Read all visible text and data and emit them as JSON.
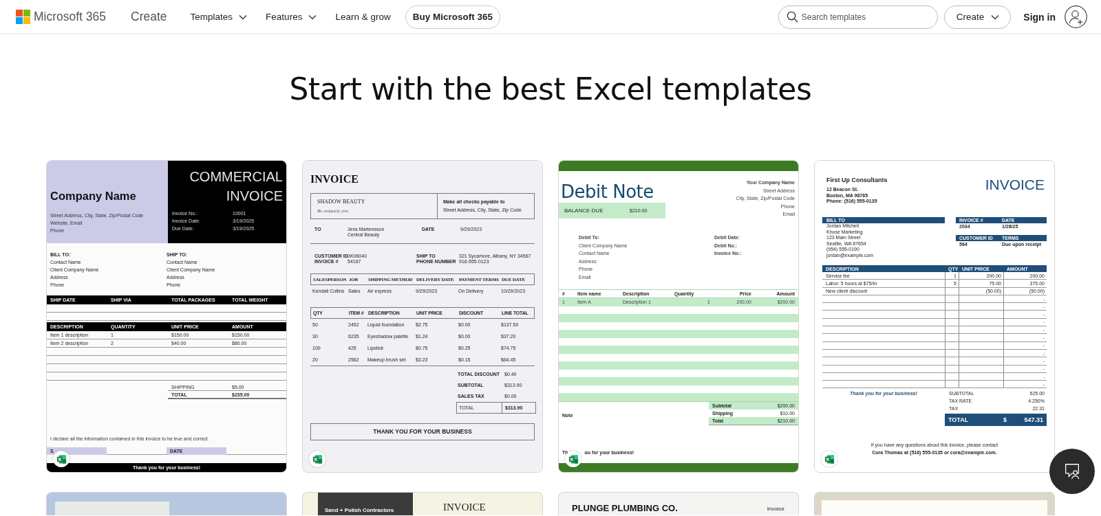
{
  "header": {
    "brand": "Microsoft 365",
    "section": "Create",
    "nav": [
      {
        "label": "Templates",
        "dropdown": true
      },
      {
        "label": "Features",
        "dropdown": true
      },
      {
        "label": "Learn & grow",
        "dropdown": false
      }
    ],
    "buy_button": "Buy Microsoft 365",
    "search": {
      "placeholder": "Search templates"
    },
    "create_button": "Create",
    "sign_in": "Sign in"
  },
  "heading": "Start with the best Excel templates",
  "templates": [
    {
      "kind": "commercial",
      "company": "Company Name",
      "company_lines": [
        "Street Address, City, State, Zip/Postal Code",
        "Website, Email",
        "Phone"
      ],
      "title_lines": [
        "COMMERCIAL",
        "INVOICE"
      ],
      "meta": [
        [
          "Invoice No.:",
          "10001"
        ],
        [
          "Invoice Date:",
          "3/19/2025"
        ],
        [
          "Due Date:",
          "3/19/2025"
        ]
      ],
      "bill_to": [
        "BILL TO:",
        "Contact Name",
        "Client Company Name",
        "Address",
        "Phone"
      ],
      "ship_to": [
        "SHIP TO:",
        "Contact Name",
        "Client Company Name",
        "Address",
        "Phone"
      ],
      "ship_columns": [
        "SHIP DATE",
        "SHIP VIA",
        "TOTAL PACKAGES",
        "TOTAL WEIGHT"
      ],
      "item_columns": [
        "DESCRIPTION",
        "QUANTITY",
        "UNIT PRICE",
        "AMOUNT"
      ],
      "items": [
        [
          "Item 1 description",
          "1",
          "$150.00",
          "$150.00"
        ],
        [
          "Item 2 description",
          "2",
          "$40.00",
          "$80.00"
        ]
      ],
      "totals": [
        [
          "SHIPPING",
          "$5.00"
        ],
        [
          "TOTAL",
          "$235.00"
        ]
      ],
      "declaration": "I declare all the information contained in this invoice to be true and correct.",
      "signature_label": "S",
      "date_label": "DATE",
      "footer": "Thank you for your business!"
    },
    {
      "kind": "service",
      "title": "INVOICE",
      "company": "SHADOW BEAUTY",
      "tagline": "Be uniquely you",
      "payable_label": "Make all checks payable to",
      "payable_address": "Street Address, City, State, Zip Code",
      "to_label": "TO",
      "to_lines": [
        "Jens Martensson",
        "Central Beauty"
      ],
      "date_label": "DATE",
      "date": "9/29/2023",
      "info": [
        {
          "labels": [
            "CUSTOMER ID",
            "INVOICE #"
          ],
          "values": [
            "0K06040",
            "54167"
          ]
        },
        {
          "labels": [
            "SHIP TO",
            "PHONE NUMBER"
          ],
          "values": [
            "321 Sycamore, Albany, NY 34567",
            "916-555-0123"
          ]
        }
      ],
      "order_columns": [
        "SALESPERSON",
        "JOB",
        "SHIPPING METHOD",
        "DELIVERY DATE",
        "PAYMENT TERMS",
        "DUE DATE"
      ],
      "order_row": [
        "Kendall Collins",
        "Sales",
        "Air express",
        "9/29/2023",
        "On Delivery",
        "10/29/2023"
      ],
      "item_columns": [
        "QTY",
        "ITEM #",
        "DESCRIPTION",
        "UNIT PRICE",
        "DISCOUNT",
        "LINE TOTAL"
      ],
      "items": [
        [
          "50",
          "2452",
          "Liquid foundation",
          "$2.75",
          "$0.00",
          "$137.50"
        ],
        [
          "30",
          "6235",
          "Eyeshadow palette",
          "$1.24",
          "$0.00",
          "$37.20"
        ],
        [
          "100",
          "425",
          "Lipstick",
          "$0.75",
          "$0.25",
          "$74.75"
        ],
        [
          "20",
          "2562",
          "Makeup brush set",
          "$3.23",
          "$0.15",
          "$64.45"
        ]
      ],
      "totals": [
        [
          "TOTAL DISCOUNT",
          "$0.40"
        ],
        [
          "SUBTOTAL",
          "$313.90"
        ],
        [
          "SALES TAX",
          "$0.00"
        ]
      ],
      "grand_total": [
        "TOTAL",
        "$313.90"
      ],
      "thanks": "THANK YOU FOR YOUR BUSINESS"
    },
    {
      "kind": "debit",
      "title": "Debit Note",
      "balance_label": "BALANCE DUE",
      "balance": "$210.00",
      "company_lines": [
        "Your Company Name",
        "Street Address",
        "City, State, Zip/Postal Code",
        "Phone",
        "Email"
      ],
      "debit_to": [
        "Debit To:",
        "Client Company Name",
        "Contact Name",
        "Address",
        "Phone",
        "Email"
      ],
      "debit_fields": [
        "Debit Date:",
        "Debit No.:",
        "Invoice No.:"
      ],
      "columns": [
        "#",
        "Item name",
        "Description",
        "Quantity",
        "Price",
        "Amount"
      ],
      "items": [
        [
          "1",
          "Item A",
          "Description 1",
          "1",
          "200.00",
          "$200.00"
        ]
      ],
      "totals": [
        [
          "Subtotal",
          "$200.00"
        ],
        [
          "Shipping",
          "$10.00"
        ],
        [
          "Total",
          "$210.00"
        ]
      ],
      "note_label": "Note",
      "thanks": [
        "Th",
        "ou for your business!"
      ]
    },
    {
      "kind": "consulting",
      "company": "First Up Consultants",
      "title": "INVOICE",
      "company_lines": [
        "12 Beacon St.",
        "Boston, MA 98765",
        "Phone: (516) 555-0135"
      ],
      "bill_to_label": "BILL TO",
      "bill_to": [
        "Jordan Mitchell",
        "Khuse Marketing",
        "123 Main Street",
        "Seattle, WA 87654",
        "(954) 555-0190",
        "jordan@example.com"
      ],
      "meta": [
        {
          "labels": [
            "INVOICE #",
            "DATE"
          ],
          "values": [
            "2034",
            "1/28/25"
          ]
        },
        {
          "labels": [
            "CUSTOMER ID",
            "TERMS"
          ],
          "values": [
            "564",
            "Due upon receipt"
          ]
        }
      ],
      "columns": [
        "DESCRIPTION",
        "QTY",
        "UNIT PRICE",
        "AMOUNT"
      ],
      "items": [
        {
          "description": "Service fee",
          "qty": "1",
          "unit_price": "200.00",
          "amount": "200.00"
        },
        {
          "description": "Labor: 5 hours at $75/hr",
          "qty": "5",
          "unit_price": "75.00",
          "amount": "375.00"
        },
        {
          "description": "New client discount",
          "unit_price": "(50.00)",
          "amount": "(50.00)"
        }
      ],
      "blank_amounts": [
        "-",
        "-",
        "-",
        "-",
        "-",
        "-",
        "-",
        "-",
        "-",
        "-",
        "-",
        "-"
      ],
      "thanks": "Thank you for your business!",
      "totals": [
        [
          "SUBTOTAL",
          "525.00"
        ],
        [
          "TAX RATE",
          "4.250%"
        ],
        [
          "TAX",
          "22.31"
        ]
      ],
      "grand_total": {
        "label": "TOTAL",
        "currency": "$",
        "amount": "547.31"
      },
      "contact_lines": [
        "If you have any questions about this invoice, please contact",
        "Cora Thomas at (516) 555-0135 or cora@example.com."
      ]
    }
  ],
  "more_templates": [
    {
      "kind": "blue_frame"
    },
    {
      "kind": "contractor",
      "company": "Sand + Polish Contractors",
      "title": "INVOICE"
    },
    {
      "kind": "plumbing",
      "company": "PLUNGE PLUMBING CO.",
      "title": "Invoice"
    },
    {
      "kind": "beige_frame"
    }
  ]
}
